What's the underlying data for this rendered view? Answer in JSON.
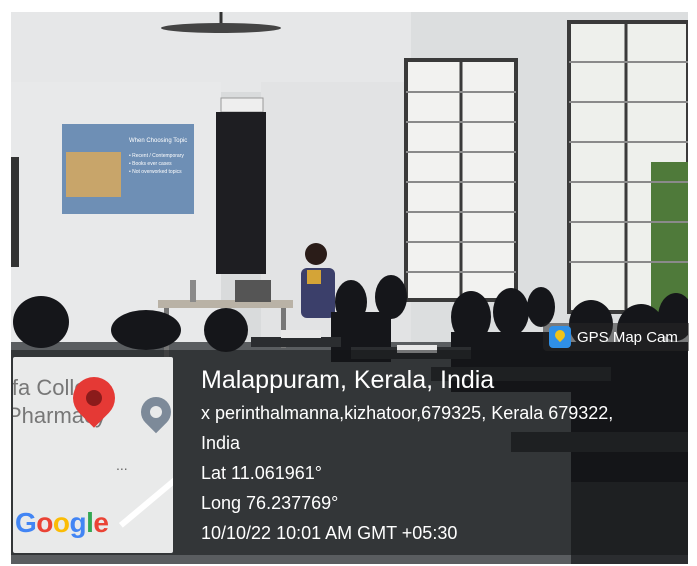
{
  "badge": {
    "label": "GPS Map Cam"
  },
  "map": {
    "label_line1": "ifa College",
    "label_line2": "Pharmacy",
    "brand": "Google",
    "ellipsis": "..."
  },
  "location": {
    "title": "Malappuram, Kerala, India",
    "address_line1": "x perinthalmanna,kizhatoor,679325, Kerala 679322,",
    "address_line2": "India",
    "lat": "Lat 11.061961°",
    "long": "Long 76.237769°",
    "datetime": "10/10/22 10:01 AM GMT +05:30"
  },
  "slide": {
    "heading": "When Choosing Topic",
    "bullets": [
      "Recent / Contemporary",
      "Books ever cases",
      "Not overworked topics"
    ]
  },
  "colors": {
    "pin": "#e53935",
    "google_blue": "#4285f4",
    "google_red": "#ea4335",
    "google_yellow": "#fbbc05",
    "google_green": "#34a853"
  }
}
